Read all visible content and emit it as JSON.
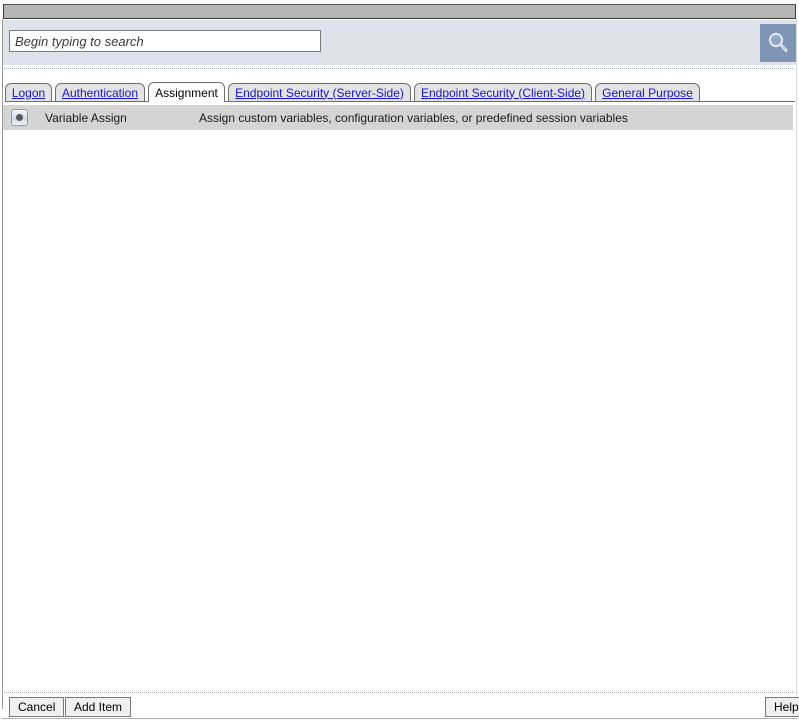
{
  "window": {
    "title": ""
  },
  "search": {
    "placeholder": "Begin typing to search",
    "value": "",
    "button_icon": "search-icon",
    "button_color": "#7e95b5"
  },
  "tabs": [
    {
      "label": "Logon",
      "selected": false
    },
    {
      "label": "Authentication",
      "selected": false
    },
    {
      "label": "Assignment",
      "selected": true
    },
    {
      "label": "Endpoint Security (Server-Side)",
      "selected": false
    },
    {
      "label": "Endpoint Security (Client-Side)",
      "selected": false
    },
    {
      "label": "General Purpose",
      "selected": false
    }
  ],
  "items": [
    {
      "name": "Variable Assign",
      "description": "Assign custom variables, configuration variables, or predefined session variables",
      "selected": true,
      "radio_icon": "radio-selected-icon"
    }
  ],
  "footer": {
    "cancel_label": "Cancel",
    "add_item_label": "Add Item",
    "help_label": "Help"
  },
  "annotations": {
    "color": "#f2220e",
    "boxes": [
      {
        "target": "Assignment tab"
      },
      {
        "target": "Variable Assign radio button"
      },
      {
        "target": "Add Item button"
      }
    ]
  }
}
